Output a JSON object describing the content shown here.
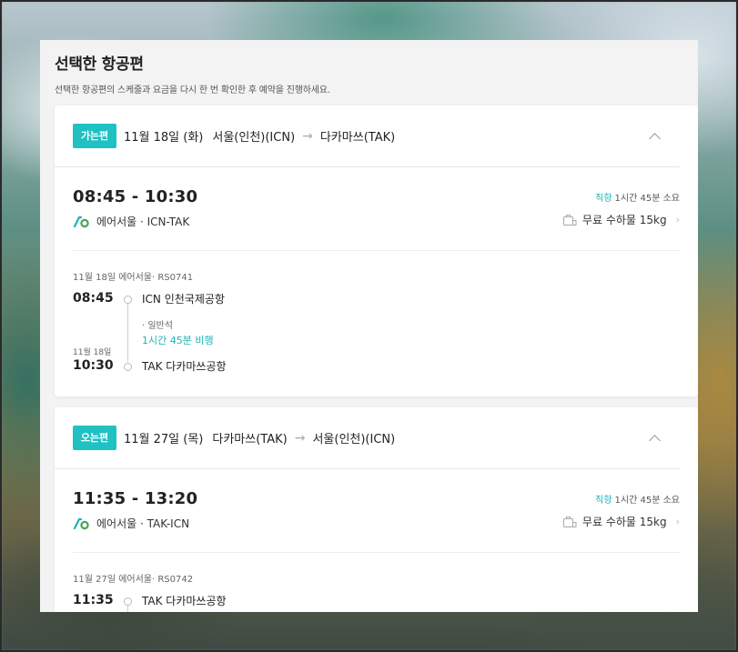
{
  "panel": {
    "title": "선택한 항공편",
    "subtitle": "선택한 항공편의 스케줄과 요금을 다시 한 번 확인한 후 예약을 진행하세요."
  },
  "colors": {
    "accent": "#1fc1c3",
    "accent_text": "#1fb3b5"
  },
  "outbound": {
    "badge": "가는편",
    "date": "11월 18일 (화)",
    "from": "서울(인천)(ICN)",
    "arrow": "→",
    "to": "다카마쓰(TAK)",
    "time_range": "08:45 - 10:30",
    "airline_route": "에어서울 · ICN-TAK",
    "direct_label": "직항",
    "duration_text": "1시간 45분 소요",
    "baggage": "무료 수하물 15kg",
    "meta": "11월 18일 에어서울· RS0741",
    "dep_time": "08:45",
    "dep_airport": "ICN 인천국제공항",
    "cabin": "· 일반석",
    "flight_duration": "1시간 45분 비행",
    "arr_date": "11월 18일",
    "arr_time": "10:30",
    "arr_airport": "TAK 다카마쓰공항"
  },
  "inbound": {
    "badge": "오는편",
    "date": "11월 27일 (목)",
    "from": "다카마쓰(TAK)",
    "arrow": "→",
    "to": "서울(인천)(ICN)",
    "time_range": "11:35 - 13:20",
    "airline_route": "에어서울 · TAK-ICN",
    "direct_label": "직항",
    "duration_text": "1시간 45분 소요",
    "baggage": "무료 수하물 15kg",
    "meta": "11월 27일 에어서울· RS0742",
    "dep_time": "11:35",
    "dep_airport": "TAK 다카마쓰공항"
  }
}
